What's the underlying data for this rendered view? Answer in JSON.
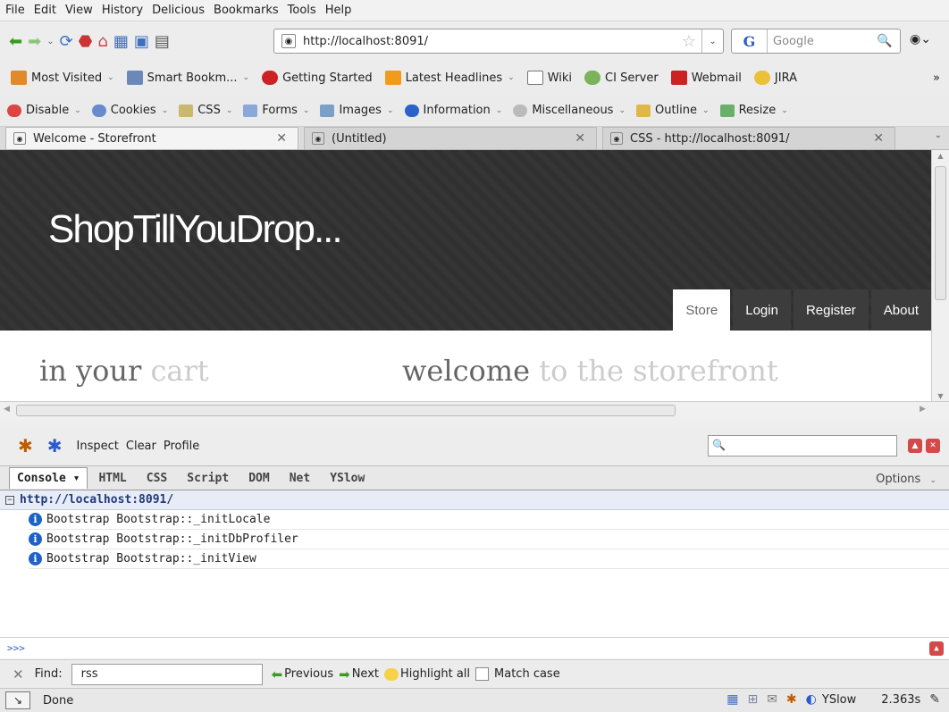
{
  "menu": [
    "File",
    "Edit",
    "View",
    "History",
    "Delicious",
    "Bookmarks",
    "Tools",
    "Help"
  ],
  "nav": {
    "url": "http://localhost:8091/",
    "search_placeholder": "Google"
  },
  "bookmarks": [
    "Most Visited",
    "Smart Bookm...",
    "Getting Started",
    "Latest Headlines",
    "Wiki",
    "CI Server",
    "Webmail",
    "JIRA"
  ],
  "bookmarks_overflow": "»",
  "webdev": [
    "Disable",
    "Cookies",
    "CSS",
    "Forms",
    "Images",
    "Information",
    "Miscellaneous",
    "Outline",
    "Resize"
  ],
  "tabs": [
    "Welcome - Storefront",
    "(Untitled)",
    "CSS - http://localhost:8091/"
  ],
  "site": {
    "logo": "ShopTillYouDrop...",
    "nav": [
      "Store",
      "Login",
      "Register",
      "About"
    ],
    "heading1_a": "in your",
    "heading1_b": "cart",
    "heading2_a": "welcome",
    "heading2_b": "to the storefront"
  },
  "firebug": {
    "tools": [
      "Inspect",
      "Clear",
      "Profile"
    ],
    "panels": [
      "Console",
      "HTML",
      "CSS",
      "Script",
      "DOM",
      "Net",
      "YSlow"
    ],
    "options": "Options",
    "group_url": "http://localhost:8091/",
    "logs": [
      "Bootstrap Bootstrap::_initLocale",
      "Bootstrap Bootstrap::_initDbProfiler",
      "Bootstrap Bootstrap::_initView"
    ],
    "prompt": ">>>"
  },
  "find": {
    "label": "Find:",
    "value": "rss",
    "previous": "Previous",
    "next": "Next",
    "highlight": "Highlight all",
    "match_case": "Match case"
  },
  "status": {
    "text": "Done",
    "yslow": "YSlow",
    "time": "2.363s"
  },
  "icons": {
    "back": "arrow-left-icon",
    "forward": "arrow-right-icon",
    "reload": "reload-icon",
    "stop": "stop-icon",
    "home": "home-icon"
  },
  "colors": {
    "accent": "#2c5bc4",
    "hero": "#333333",
    "info": "#1e62c8"
  }
}
